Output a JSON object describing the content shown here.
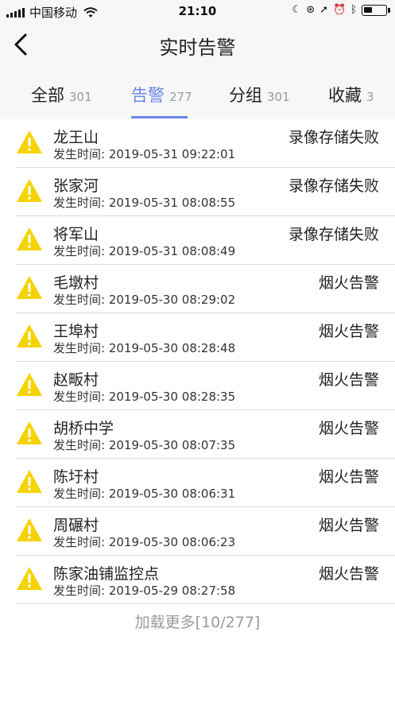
{
  "status_bar": {
    "carrier": "中国移动",
    "time": "21:10"
  },
  "nav": {
    "title": "实时告警"
  },
  "tabs": [
    {
      "label": "全部",
      "count": "301"
    },
    {
      "label": "告警",
      "count": "277",
      "active": true
    },
    {
      "label": "分组",
      "count": "301"
    },
    {
      "label": "收藏",
      "count": "3"
    }
  ],
  "alarm_time_prefix": "发生时间: ",
  "alarms": [
    {
      "location": "龙王山",
      "time": "2019-05-31 09:22:01",
      "type": "录像存储失败"
    },
    {
      "location": "张家河",
      "time": "2019-05-31 08:08:55",
      "type": "录像存储失败"
    },
    {
      "location": "将军山",
      "time": "2019-05-31 08:08:49",
      "type": "录像存储失败"
    },
    {
      "location": "毛墩村",
      "time": "2019-05-30 08:29:02",
      "type": "烟火告警"
    },
    {
      "location": "王埠村",
      "time": "2019-05-30 08:28:48",
      "type": "烟火告警"
    },
    {
      "location": "赵畈村",
      "time": "2019-05-30 08:28:35",
      "type": "烟火告警"
    },
    {
      "location": "胡桥中学",
      "time": "2019-05-30 08:07:35",
      "type": "烟火告警"
    },
    {
      "location": "陈圩村",
      "time": "2019-05-30 08:06:31",
      "type": "烟火告警"
    },
    {
      "location": "周碾村",
      "time": "2019-05-30 08:06:23",
      "type": "烟火告警"
    },
    {
      "location": "陈家油铺监控点",
      "time": "2019-05-29 08:27:58",
      "type": "烟火告警"
    }
  ],
  "load_more": "加载更多[10/277]",
  "colors": {
    "accent": "#6b85e8",
    "warning": "#f5d300"
  }
}
